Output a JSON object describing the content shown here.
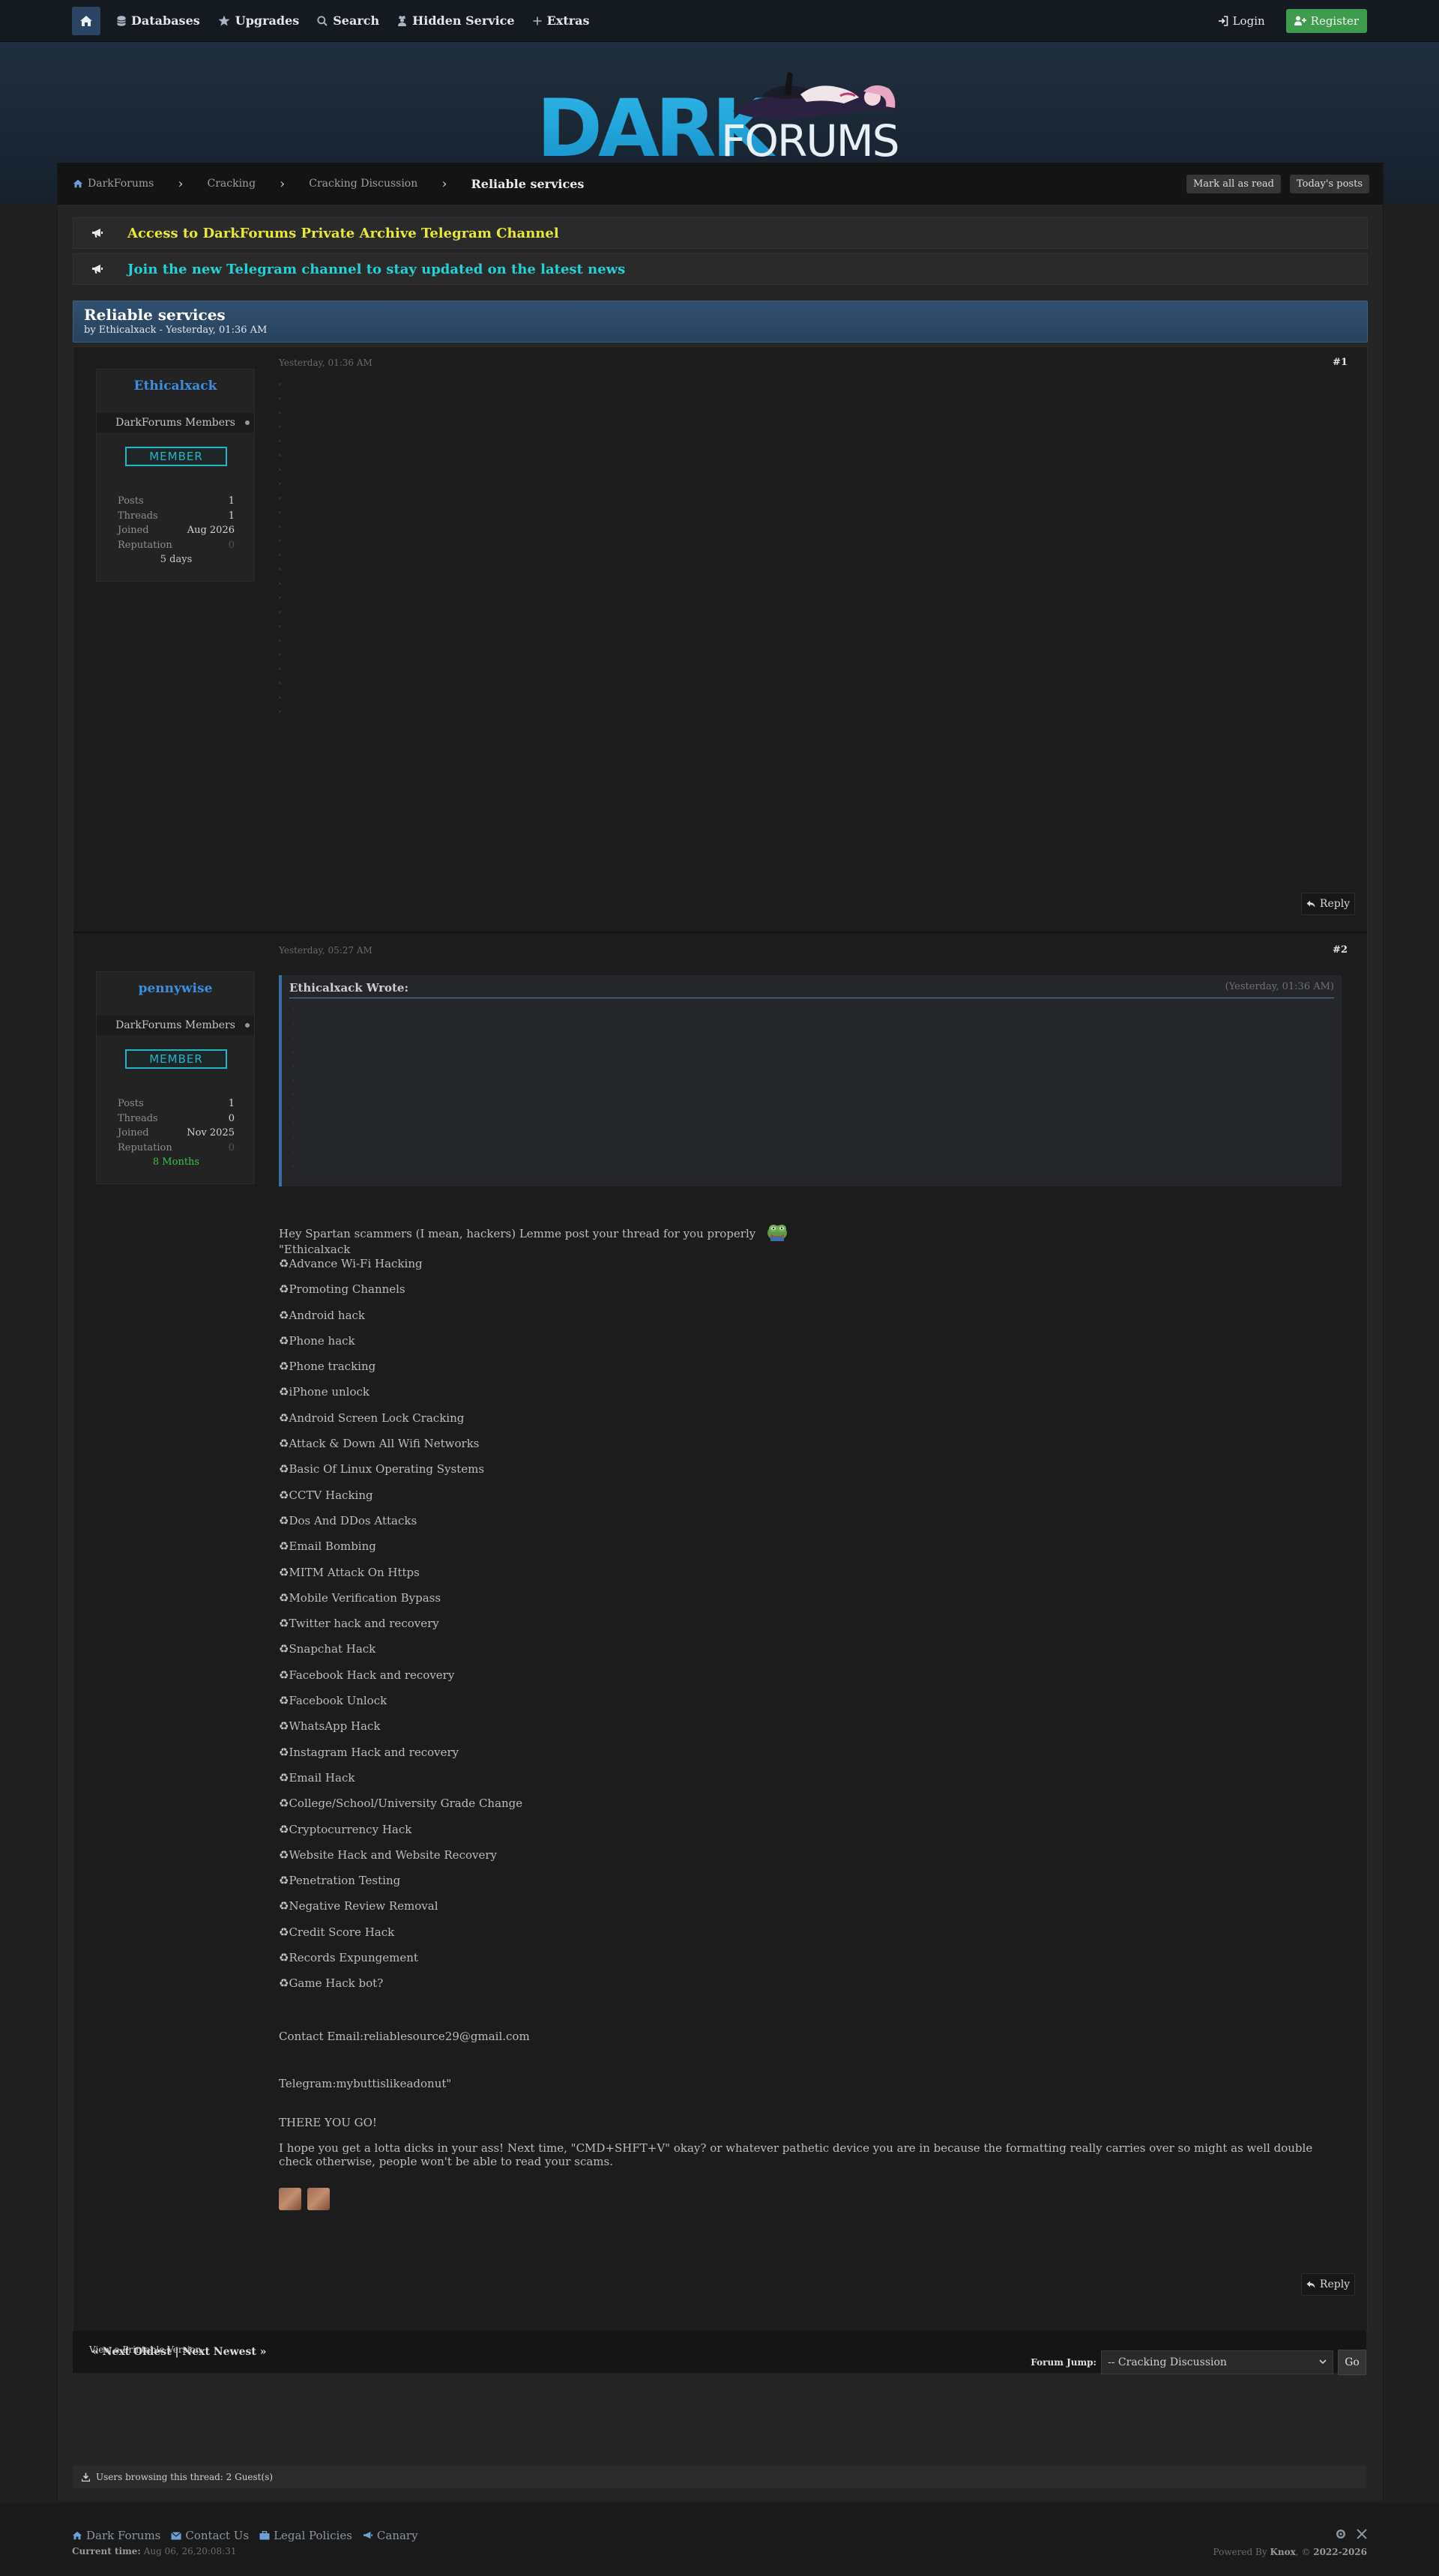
{
  "nav": {
    "items": [
      {
        "label": "Databases",
        "icon": "database-icon"
      },
      {
        "label": "Upgrades",
        "icon": "star-icon"
      },
      {
        "label": "Search",
        "icon": "search-icon"
      },
      {
        "label": "Hidden Service",
        "icon": "user-secret-icon"
      },
      {
        "label": "Extras",
        "icon": "plus-icon"
      }
    ],
    "login_label": "Login",
    "register_label": "Register"
  },
  "logo": {
    "text_dark": "DARK",
    "text_forums": "FORUMS"
  },
  "breadcrumb": {
    "items": [
      "DarkForums",
      "Cracking",
      "Cracking Discussion"
    ],
    "current": "Reliable services"
  },
  "buttons": {
    "mark_read": "Mark all as read",
    "todays_posts": "Today's posts"
  },
  "announcements": [
    {
      "text": "Access to DarkForums Private Archive Telegram Channel",
      "color": "#e8e83a"
    },
    {
      "text": "Join the new Telegram channel to stay updated on the latest news",
      "color": "#22d3d6"
    }
  ],
  "thread": {
    "title": "Reliable services",
    "subtitle": "by Ethicalxack - Yesterday, 01:36 AM"
  },
  "posts": [
    {
      "number": "#1",
      "date": "Yesterday, 01:36 AM",
      "author": "Ethicalxack",
      "group": "DarkForums Members",
      "badge": "MEMBER",
      "stats": {
        "posts": "1",
        "threads": "1",
        "joined": "Aug 2026",
        "reputation": "0",
        "age": "5 days"
      },
      "reply_label": "Reply"
    },
    {
      "number": "#2",
      "date": "Yesterday, 05:27 AM",
      "author": "pennywise",
      "group": "DarkForums Members",
      "badge": "MEMBER",
      "stats": {
        "posts": "1",
        "threads": "0",
        "joined": "Nov 2025",
        "reputation": "0",
        "age": "8 Months"
      },
      "quote": {
        "author": "Ethicalxack Wrote:",
        "date": "(Yesterday, 01:36 AM)"
      },
      "intro": "Hey Spartan scammers (I mean, hackers) Lemme post your thread for you properly",
      "quote_open": "\"Ethicalxack",
      "services": [
        "Advance Wi-Fi Hacking",
        "Promoting Channels",
        "Android hack",
        "Phone hack",
        "Phone tracking",
        "iPhone unlock",
        "Android Screen Lock Cracking",
        "Attack & Down All Wifi Networks",
        "Basic Of Linux Operating Systems",
        "CCTV Hacking",
        "Dos And DDos Attacks",
        "Email Bombing",
        "MITM Attack On Https",
        "Mobile Verification Bypass",
        "Twitter hack and recovery",
        "Snapchat Hack",
        "Facebook Hack and recovery",
        "Facebook Unlock",
        "WhatsApp Hack",
        "Instagram Hack and recovery",
        "Email Hack",
        "College/School/University Grade Change",
        "Cryptocurrency Hack",
        "Website Hack and Website Recovery",
        "Penetration Testing",
        "Negative Review Removal",
        "Credit Score Hack",
        "Records Expungement",
        "Game Hack bot?"
      ],
      "contact": "Contact Email:reliablesource29@gmail.com",
      "telegram": "Telegram:mybuttislikeadonut\"",
      "there": "THERE YOU GO!",
      "rant": "I hope you get a lotta dicks in your ass! Next time, \"CMD+SHFT+V\" okay? or whatever pathetic device you are in because the formatting really carries over so might as well double check otherwise, people won't be able to read your scams.",
      "reply_label": "Reply"
    }
  ],
  "labels": {
    "posts": "Posts",
    "threads": "Threads",
    "joined": "Joined",
    "reputation": "Reputation"
  },
  "thread_nav": "« Next Oldest | Next Newest »",
  "printable": "View a Printable Version",
  "forum_jump": {
    "label": "Forum Jump:",
    "selected": "-- Cracking Discussion",
    "go": "Go"
  },
  "browsing": "Users browsing this thread: 2 Guest(s)",
  "footer": {
    "links": [
      "Dark Forums",
      "Contact Us",
      "Legal Policies",
      "Canary"
    ],
    "current_time_label": "Current time:",
    "current_time": "Aug 06, 26,20:08:31",
    "powered_by": "Powered By",
    "powered_name": "Knox",
    "years": "2022-2026"
  }
}
